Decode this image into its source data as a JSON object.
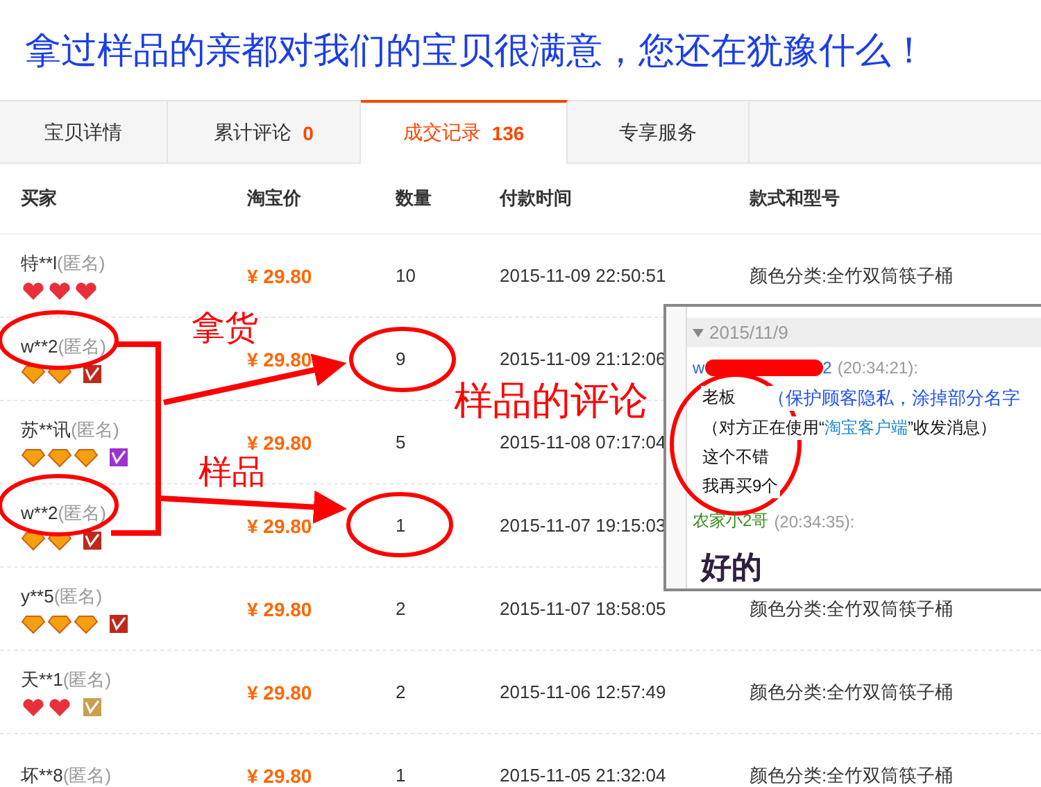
{
  "banner": {
    "text": "拿过样品的亲都对我们的宝贝很满意，您还在犹豫什么！"
  },
  "tabs": [
    {
      "label": "宝贝详情",
      "selected": false
    },
    {
      "label": "累计评论",
      "count": "0",
      "selected": false
    },
    {
      "label": "成交记录",
      "count": "136",
      "selected": true
    },
    {
      "label": "专享服务",
      "selected": false
    }
  ],
  "table": {
    "columns": [
      "买家",
      "淘宝价",
      "数量",
      "付款时间",
      "款式和型号"
    ],
    "rows": [
      {
        "buyer": "特**l",
        "anon": "(匿名)",
        "ranks": [
          {
            "kind": "heart"
          },
          {
            "kind": "heart"
          },
          {
            "kind": "heart"
          }
        ],
        "price": "¥ 29.80",
        "qty": "10",
        "time": "2015-11-09 22:50:51",
        "style": "颜色分类:全竹双筒筷子桶"
      },
      {
        "buyer": "w**2",
        "anon": "(匿名)",
        "ranks": [
          {
            "kind": "diamond"
          },
          {
            "kind": "diamond"
          }
        ],
        "vip": {
          "color": "#c0281c"
        },
        "price": "¥ 29.80",
        "qty": "9",
        "time": "2015-11-09 21:12:06"
      },
      {
        "buyer": "苏**讯",
        "anon": "(匿名)",
        "ranks": [
          {
            "kind": "diamond"
          },
          {
            "kind": "diamond"
          },
          {
            "kind": "diamond"
          }
        ],
        "vip": {
          "color": "#a030d0"
        },
        "price": "¥ 29.80",
        "qty": "5",
        "time": "2015-11-08 07:17:04"
      },
      {
        "buyer": "w**2",
        "anon": "(匿名)",
        "ranks": [
          {
            "kind": "diamond"
          },
          {
            "kind": "diamond"
          }
        ],
        "vip": {
          "color": "#c0281c"
        },
        "price": "¥ 29.80",
        "qty": "1",
        "time": "2015-11-07 19:15:03"
      },
      {
        "buyer": "y**5",
        "anon": "(匿名)",
        "ranks": [
          {
            "kind": "diamond"
          },
          {
            "kind": "diamond"
          },
          {
            "kind": "diamond"
          }
        ],
        "vip": {
          "color": "#c0281c"
        },
        "price": "¥ 29.80",
        "qty": "2",
        "time": "2015-11-07 18:58:05",
        "style": "颜色分类:全竹双筒筷子桶"
      },
      {
        "buyer": "天**1",
        "anon": "(匿名)",
        "ranks": [
          {
            "kind": "heart"
          },
          {
            "kind": "heart"
          }
        ],
        "vip": {
          "color": "#c8a050"
        },
        "price": "¥ 29.80",
        "qty": "2",
        "time": "2015-11-06 12:57:49",
        "style": "颜色分类:全竹双筒筷子桶"
      },
      {
        "buyer": "坏**8",
        "anon": "(匿名)",
        "price": "¥ 29.80",
        "qty": "1",
        "time": "2015-11-05 21:32:04",
        "style": "颜色分类:全竹双筒筷子桶"
      }
    ]
  },
  "chat": {
    "date": "2015/11/9",
    "messages": [
      {
        "kind": "buyer",
        "name_parts": [
          "w",
          "2"
        ],
        "redacted": true,
        "time": "(20:34:21):",
        "lines": [
          {
            "kind": "text",
            "text": "老板",
            "note": "（保护顾客隐私，涂掉部分名字"
          },
          {
            "kind": "notice",
            "before": "（对方正在使用“",
            "link": "淘宝客户端",
            "after": "”收发消息）"
          },
          {
            "kind": "text",
            "text": "这个不错"
          },
          {
            "kind": "text",
            "text": "我再买9个"
          }
        ]
      },
      {
        "kind": "seller",
        "name_parts": [
          "农家小2哥"
        ],
        "redacted": false,
        "time": "(20:34:35):",
        "lines": [
          {
            "kind": "big",
            "text": "好的"
          }
        ]
      }
    ]
  },
  "annotations": [
    {
      "text": "拿货"
    },
    {
      "text": "样品"
    },
    {
      "text": "样品的评论"
    }
  ]
}
